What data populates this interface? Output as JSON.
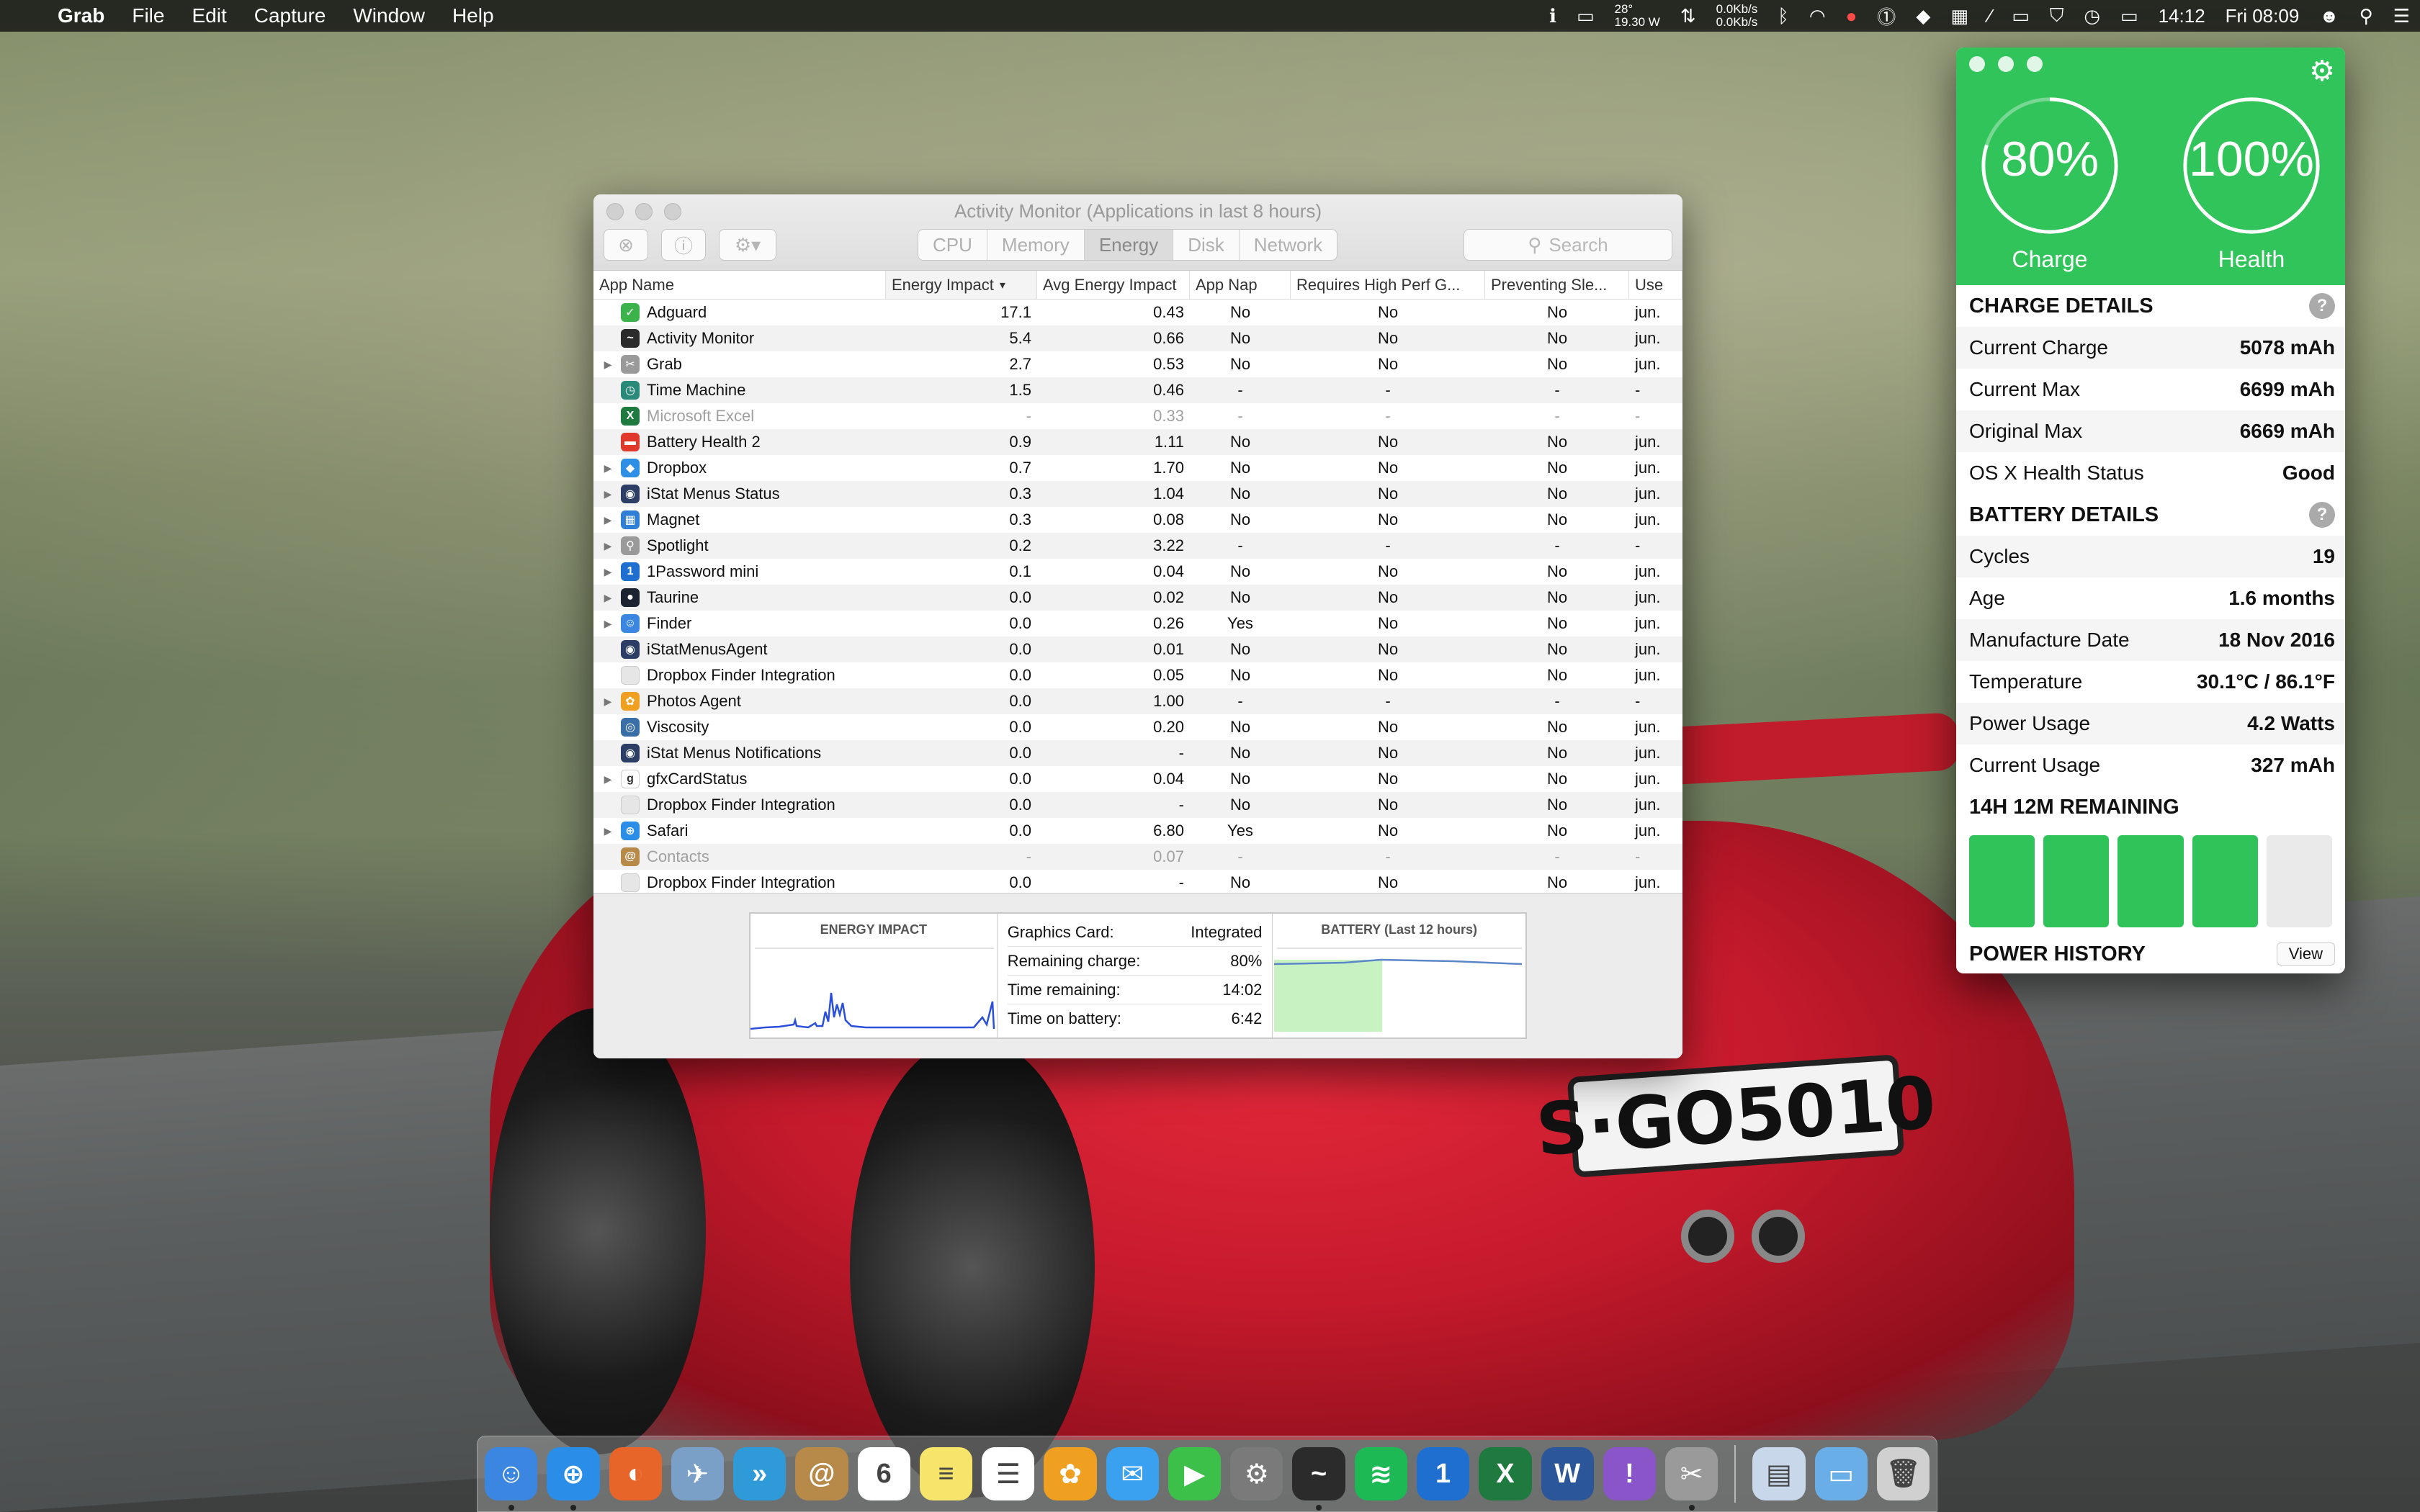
{
  "menubar": {
    "app_name": "Grab",
    "menus": [
      "File",
      "Edit",
      "Capture",
      "Window",
      "Help"
    ],
    "weather_temp": "28°",
    "weather_power": "19.30 W",
    "net_up": "0.0Kb/s",
    "net_down": "0.0Kb/s",
    "clock_time": "14:12",
    "clock_day": "Fri 08:09"
  },
  "activity_monitor": {
    "title": "Activity Monitor (Applications in last 8 hours)",
    "tabs": [
      "CPU",
      "Memory",
      "Energy",
      "Disk",
      "Network"
    ],
    "active_tab": "Energy",
    "search_placeholder": "Search",
    "columns": [
      "App Name",
      "Energy Impact",
      "Avg Energy Impact",
      "App Nap",
      "Requires High Perf G...",
      "Preventing Sle...",
      "Use"
    ],
    "rows": [
      {
        "name": "Adguard",
        "energy": "17.1",
        "avg": "0.43",
        "nap": "No",
        "perf": "No",
        "sleep": "No",
        "user": "jun.",
        "disclosure": "",
        "icon_color": "#3cb34a",
        "icon_glyph": "✓",
        "dim": false
      },
      {
        "name": "Activity Monitor",
        "energy": "5.4",
        "avg": "0.66",
        "nap": "No",
        "perf": "No",
        "sleep": "No",
        "user": "jun.",
        "disclosure": "",
        "icon_color": "#2b2b2b",
        "icon_glyph": "~",
        "dim": false
      },
      {
        "name": "Grab",
        "energy": "2.7",
        "avg": "0.53",
        "nap": "No",
        "perf": "No",
        "sleep": "No",
        "user": "jun.",
        "disclosure": "▶",
        "icon_color": "#9a9a9a",
        "icon_glyph": "✂",
        "dim": false
      },
      {
        "name": "Time Machine",
        "energy": "1.5",
        "avg": "0.46",
        "nap": "-",
        "perf": "-",
        "sleep": "-",
        "user": "-",
        "disclosure": "",
        "icon_color": "#2a8a7a",
        "icon_glyph": "◷",
        "dim": false
      },
      {
        "name": "Microsoft Excel",
        "energy": "-",
        "avg": "0.33",
        "nap": "-",
        "perf": "-",
        "sleep": "-",
        "user": "-",
        "disclosure": "",
        "icon_color": "#1f7a3f",
        "icon_glyph": "X",
        "dim": true
      },
      {
        "name": "Battery Health 2",
        "energy": "0.9",
        "avg": "1.11",
        "nap": "No",
        "perf": "No",
        "sleep": "No",
        "user": "jun.",
        "disclosure": "",
        "icon_color": "#e0392b",
        "icon_glyph": "▬",
        "dim": false
      },
      {
        "name": "Dropbox",
        "energy": "0.7",
        "avg": "1.70",
        "nap": "No",
        "perf": "No",
        "sleep": "No",
        "user": "jun.",
        "disclosure": "▶",
        "icon_color": "#2d8fe6",
        "icon_glyph": "◆",
        "dim": false
      },
      {
        "name": "iStat Menus Status",
        "energy": "0.3",
        "avg": "1.04",
        "nap": "No",
        "perf": "No",
        "sleep": "No",
        "user": "jun.",
        "disclosure": "▶",
        "icon_color": "#2c3e66",
        "icon_glyph": "◉",
        "dim": false
      },
      {
        "name": "Magnet",
        "energy": "0.3",
        "avg": "0.08",
        "nap": "No",
        "perf": "No",
        "sleep": "No",
        "user": "jun.",
        "disclosure": "▶",
        "icon_color": "#2f7fd8",
        "icon_glyph": "▦",
        "dim": false
      },
      {
        "name": "Spotlight",
        "energy": "0.2",
        "avg": "3.22",
        "nap": "-",
        "perf": "-",
        "sleep": "-",
        "user": "-",
        "disclosure": "▶",
        "icon_color": "#9a9a9a",
        "icon_glyph": "⚲",
        "dim": false
      },
      {
        "name": "1Password mini",
        "energy": "0.1",
        "avg": "0.04",
        "nap": "No",
        "perf": "No",
        "sleep": "No",
        "user": "jun.",
        "disclosure": "▶",
        "icon_color": "#1f6fd1",
        "icon_glyph": "1",
        "dim": false
      },
      {
        "name": "Taurine",
        "energy": "0.0",
        "avg": "0.02",
        "nap": "No",
        "perf": "No",
        "sleep": "No",
        "user": "jun.",
        "disclosure": "▶",
        "icon_color": "#1b2430",
        "icon_glyph": "●",
        "dim": false
      },
      {
        "name": "Finder",
        "energy": "0.0",
        "avg": "0.26",
        "nap": "Yes",
        "perf": "No",
        "sleep": "No",
        "user": "jun.",
        "disclosure": "▶",
        "icon_color": "#3a86e0",
        "icon_glyph": "☺",
        "dim": false
      },
      {
        "name": "iStatMenusAgent",
        "energy": "0.0",
        "avg": "0.01",
        "nap": "No",
        "perf": "No",
        "sleep": "No",
        "user": "jun.",
        "disclosure": "",
        "icon_color": "#2c3e66",
        "icon_glyph": "◉",
        "dim": false
      },
      {
        "name": "Dropbox Finder Integration",
        "energy": "0.0",
        "avg": "0.05",
        "nap": "No",
        "perf": "No",
        "sleep": "No",
        "user": "jun.",
        "disclosure": "",
        "icon_color": "#e6e6e6",
        "icon_glyph": "",
        "dim": false
      },
      {
        "name": "Photos Agent",
        "energy": "0.0",
        "avg": "1.00",
        "nap": "-",
        "perf": "-",
        "sleep": "-",
        "user": "-",
        "disclosure": "▶",
        "icon_color": "#f0a020",
        "icon_glyph": "✿",
        "dim": false
      },
      {
        "name": "Viscosity",
        "energy": "0.0",
        "avg": "0.20",
        "nap": "No",
        "perf": "No",
        "sleep": "No",
        "user": "jun.",
        "disclosure": "",
        "icon_color": "#3a6ea8",
        "icon_glyph": "◎",
        "dim": false
      },
      {
        "name": "iStat Menus Notifications",
        "energy": "0.0",
        "avg": "-",
        "nap": "No",
        "perf": "No",
        "sleep": "No",
        "user": "jun.",
        "disclosure": "",
        "icon_color": "#2c3e66",
        "icon_glyph": "◉",
        "dim": false
      },
      {
        "name": "gfxCardStatus",
        "energy": "0.0",
        "avg": "0.04",
        "nap": "No",
        "perf": "No",
        "sleep": "No",
        "user": "jun.",
        "disclosure": "▶",
        "icon_color": "#ffffff",
        "icon_glyph": "g",
        "dim": false
      },
      {
        "name": "Dropbox Finder Integration",
        "energy": "0.0",
        "avg": "-",
        "nap": "No",
        "perf": "No",
        "sleep": "No",
        "user": "jun.",
        "disclosure": "",
        "icon_color": "#e6e6e6",
        "icon_glyph": "",
        "dim": false
      },
      {
        "name": "Safari",
        "energy": "0.0",
        "avg": "6.80",
        "nap": "Yes",
        "perf": "No",
        "sleep": "No",
        "user": "jun.",
        "disclosure": "▶",
        "icon_color": "#2a8ee8",
        "icon_glyph": "⊕",
        "dim": false
      },
      {
        "name": "Contacts",
        "energy": "-",
        "avg": "0.07",
        "nap": "-",
        "perf": "-",
        "sleep": "-",
        "user": "-",
        "disclosure": "",
        "icon_color": "#b88a4a",
        "icon_glyph": "@",
        "dim": true
      },
      {
        "name": "Dropbox Finder Integration",
        "energy": "0.0",
        "avg": "-",
        "nap": "No",
        "perf": "No",
        "sleep": "No",
        "user": "jun.",
        "disclosure": "",
        "icon_color": "#e6e6e6",
        "icon_glyph": "",
        "dim": false
      }
    ],
    "footer": {
      "energy_title": "ENERGY IMPACT",
      "battery_title": "BATTERY (Last 12 hours)",
      "stats": [
        {
          "label": "Graphics Card:",
          "value": "Integrated"
        },
        {
          "label": "Remaining charge:",
          "value": "80%"
        },
        {
          "label": "Time remaining:",
          "value": "14:02"
        },
        {
          "label": "Time on battery:",
          "value": "6:42"
        }
      ]
    }
  },
  "battery_health": {
    "charge_pct": "80%",
    "charge_value": 0.8,
    "charge_label": "Charge",
    "health_pct": "100%",
    "health_value": 1.0,
    "health_label": "Health",
    "charge_details_title": "CHARGE DETAILS",
    "charge_details": [
      {
        "label": "Current Charge",
        "value": "5078 mAh"
      },
      {
        "label": "Current Max",
        "value": "6699 mAh"
      },
      {
        "label": "Original Max",
        "value": "6669 mAh"
      },
      {
        "label": "OS X Health Status",
        "value": "Good"
      }
    ],
    "battery_details_title": "BATTERY DETAILS",
    "battery_details": [
      {
        "label": "Cycles",
        "value": "19"
      },
      {
        "label": "Age",
        "value": "1.6 months"
      },
      {
        "label": "Manufacture Date",
        "value": "18 Nov 2016"
      },
      {
        "label": "Temperature",
        "value": "30.1°C / 86.1°F"
      },
      {
        "label": "Power Usage",
        "value": "4.2 Watts"
      },
      {
        "label": "Current Usage",
        "value": "327 mAh"
      }
    ],
    "remaining_title": "14H 12M REMAINING",
    "remaining_bars_filled": 4,
    "remaining_bars_total": 5,
    "power_history_title": "POWER HISTORY",
    "view_label": "View",
    "accent_color": "#31c45a"
  },
  "plate_text": "S·GO5010",
  "dock": {
    "apps": [
      {
        "name": "finder",
        "color": "#3a86e0",
        "glyph": "☺",
        "running": true
      },
      {
        "name": "safari",
        "color": "#2a8ee8",
        "glyph": "⊕",
        "running": true
      },
      {
        "name": "firefox",
        "color": "#e8652a",
        "glyph": "◐",
        "running": false
      },
      {
        "name": "preview",
        "color": "#7aa0c8",
        "glyph": "✈",
        "running": false
      },
      {
        "name": "fast-forward",
        "color": "#2f9ad8",
        "glyph": "»",
        "running": false
      },
      {
        "name": "contacts",
        "color": "#b88a4a",
        "glyph": "@",
        "running": false
      },
      {
        "name": "calendar",
        "color": "#ffffff",
        "glyph": "6",
        "running": false
      },
      {
        "name": "notes",
        "color": "#f7e46a",
        "glyph": "≡",
        "running": false
      },
      {
        "name": "reminders",
        "color": "#ffffff",
        "glyph": "☰",
        "running": false
      },
      {
        "name": "photos",
        "color": "#f0a020",
        "glyph": "✿",
        "running": false
      },
      {
        "name": "messages",
        "color": "#3aa0f0",
        "glyph": "✉",
        "running": false
      },
      {
        "name": "facetime",
        "color": "#3cc04a",
        "glyph": "▶",
        "running": false
      },
      {
        "name": "system-preferences",
        "color": "#7a7a7a",
        "glyph": "⚙",
        "running": false
      },
      {
        "name": "activity-monitor",
        "color": "#2b2b2b",
        "glyph": "~",
        "running": true
      },
      {
        "name": "spotify",
        "color": "#1db954",
        "glyph": "≋",
        "running": false
      },
      {
        "name": "1password",
        "color": "#1f6fd1",
        "glyph": "1",
        "running": false
      },
      {
        "name": "excel",
        "color": "#1f7a3f",
        "glyph": "X",
        "running": false
      },
      {
        "name": "word",
        "color": "#2b579a",
        "glyph": "W",
        "running": false
      },
      {
        "name": "omnifocus",
        "color": "#8a55c8",
        "glyph": "!",
        "running": false
      },
      {
        "name": "grab",
        "color": "#9a9a9a",
        "glyph": "✂",
        "running": true
      }
    ],
    "stack_items": [
      {
        "name": "documents-stack",
        "color": "#c8d8ea",
        "glyph": "▤"
      },
      {
        "name": "downloads-folder",
        "color": "#6aaee8",
        "glyph": "▭"
      },
      {
        "name": "trash",
        "color": "#d0d0d0",
        "glyph": "🗑"
      }
    ]
  }
}
